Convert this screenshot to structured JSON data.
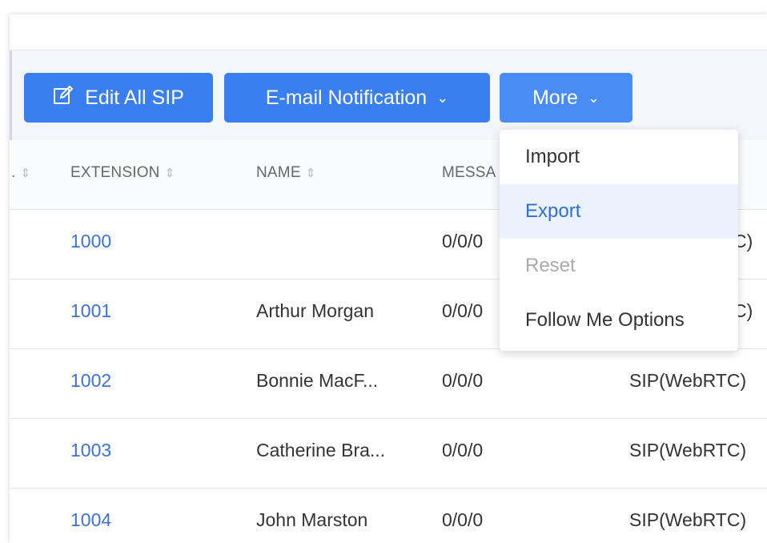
{
  "toolbar": {
    "edit_all_sip": "Edit All SIP",
    "email_notification": "E-mail Notification",
    "more": "More",
    "chevron": "⌄"
  },
  "columns": {
    "partial_left": ".",
    "extension": "EXTENSION",
    "name": "NAME",
    "message_partial": "MESSA",
    "sort_icon": "⇕"
  },
  "rows": [
    {
      "extension": "1000",
      "name": "",
      "message": "0/0/0",
      "type": "C)"
    },
    {
      "extension": "1001",
      "name": "Arthur Morgan",
      "message": "0/0/0",
      "type": "C)"
    },
    {
      "extension": "1002",
      "name": "Bonnie MacF...",
      "message": "0/0/0",
      "type": "SIP(WebRTC)"
    },
    {
      "extension": "1003",
      "name": "Catherine Bra...",
      "message": "0/0/0",
      "type": "SIP(WebRTC)"
    },
    {
      "extension": "1004",
      "name": "John Marston",
      "message": "0/0/0",
      "type": "SIP(WebRTC)"
    }
  ],
  "dropdown": {
    "items": [
      {
        "label": "Import",
        "state": "normal"
      },
      {
        "label": "Export",
        "state": "highlighted"
      },
      {
        "label": "Reset",
        "state": "disabled"
      },
      {
        "label": "Follow Me Options",
        "state": "normal"
      }
    ]
  },
  "colors": {
    "primary_button": "#3a7ff2",
    "link_blue": "#3a72d8",
    "toolbar_bg": "#f3f6fa",
    "highlight_bg": "#eaf2fd"
  }
}
